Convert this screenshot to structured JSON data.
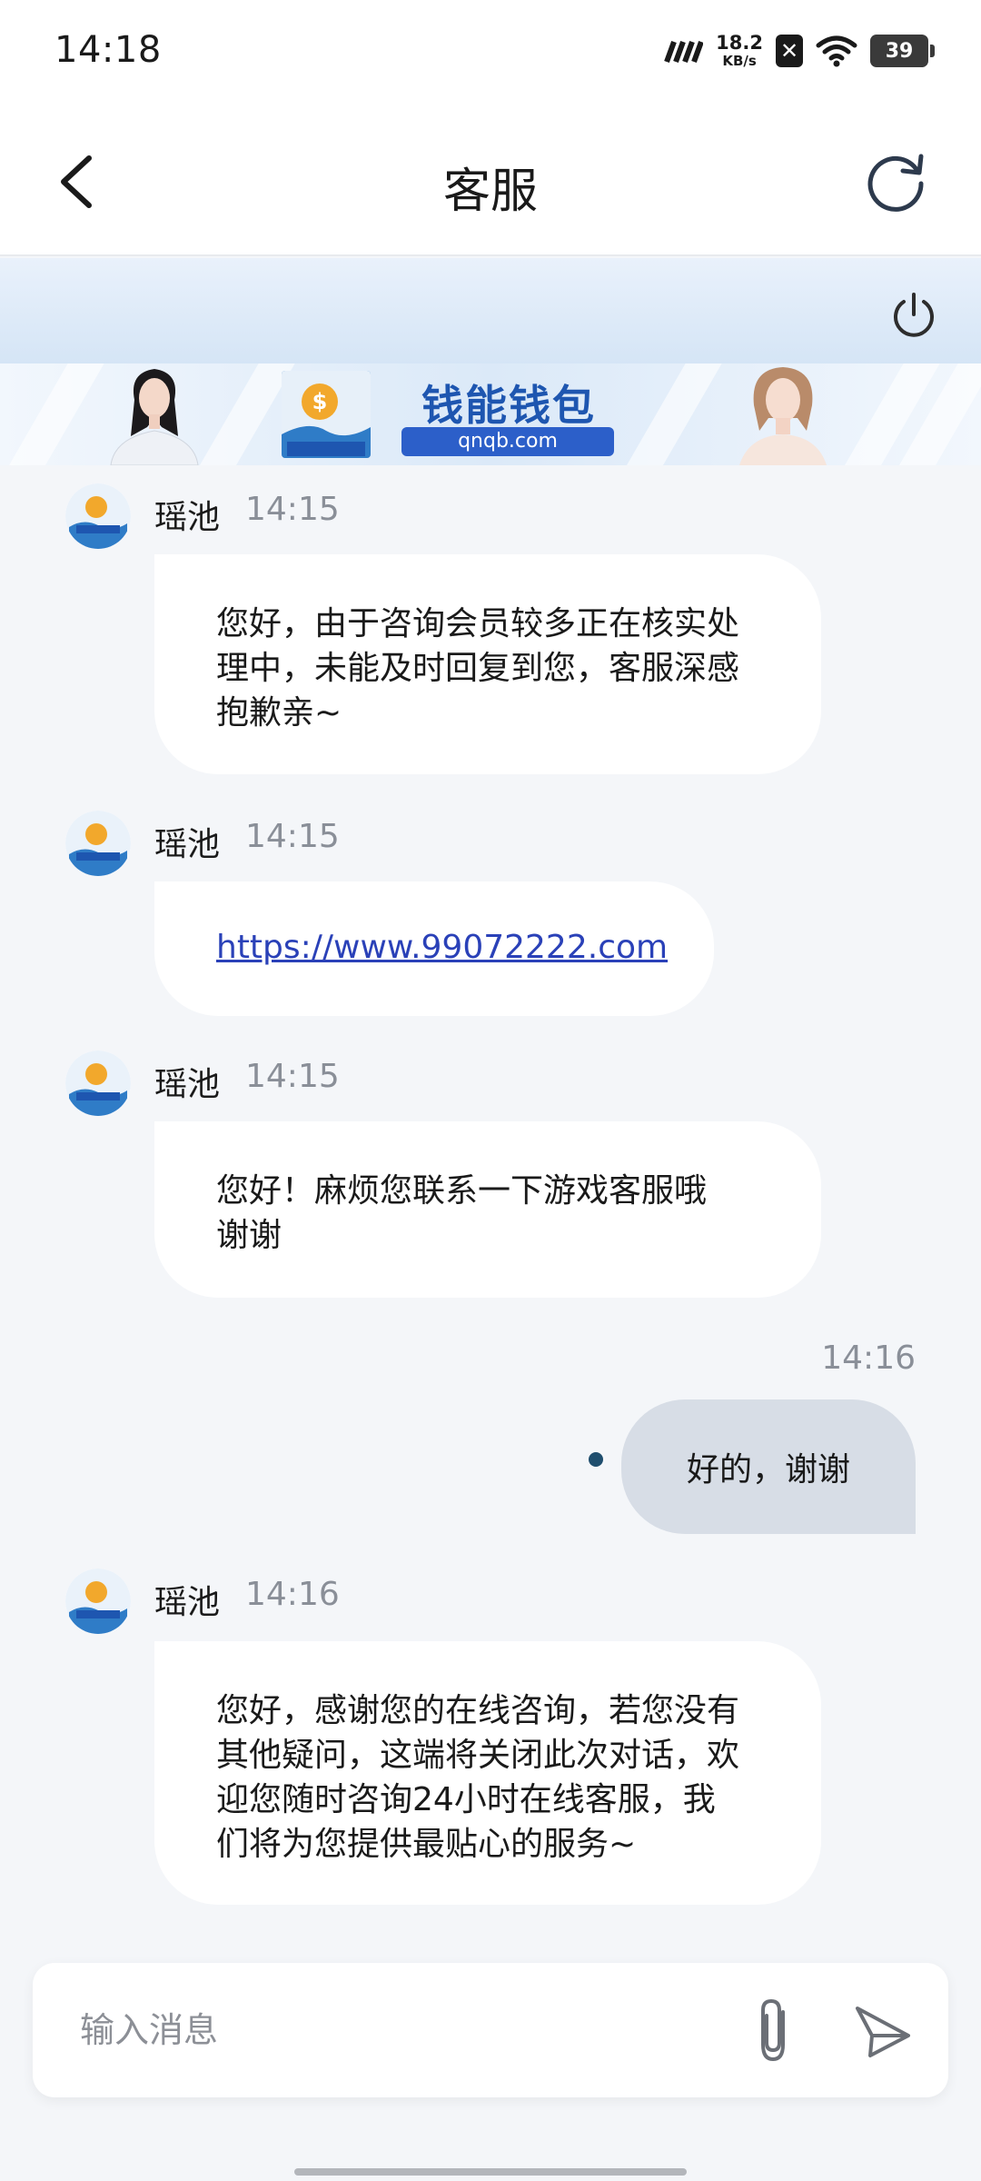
{
  "status_bar": {
    "time": "14:18",
    "net_speed_value": "18.2",
    "net_speed_unit": "KB/s",
    "battery": "39",
    "icons": [
      "signal-icon",
      "blocked-notification-icon",
      "wifi-icon",
      "battery-icon"
    ]
  },
  "header": {
    "title": "客服",
    "back_icon": "chevron-left-icon",
    "refresh_icon": "refresh-icon"
  },
  "top_panel": {
    "power_icon": "power-icon"
  },
  "ad_banner": {
    "brand": "钱能钱包",
    "url": "qnqb.com",
    "logo_text": "钱能钱包"
  },
  "messages": [
    {
      "direction": "in",
      "sender": "瑶池",
      "time": "14:15",
      "lines": [
        "您好，由于咨询会员较多正在核实处",
        "理中，未能及时回复到您，客服深感",
        "抱歉亲~"
      ]
    },
    {
      "direction": "in",
      "sender": "瑶池",
      "time": "14:15",
      "link": "https://www.99072222.com"
    },
    {
      "direction": "in",
      "sender": "瑶池",
      "time": "14:15",
      "lines": [
        "您好！麻烦您联系一下游戏客服哦",
        "谢谢"
      ]
    },
    {
      "direction": "out",
      "time": "14:16",
      "text": "好的，谢谢"
    },
    {
      "direction": "in",
      "sender": "瑶池",
      "time": "14:16",
      "lines": [
        "您好，感谢您的在线咨询，若您没有",
        "其他疑问，这端将关闭此次对话，欢",
        "迎您随时咨询24小时在线客服，我",
        "们将为您提供最贴心的服务~"
      ]
    }
  ],
  "input": {
    "placeholder": "输入消息",
    "value": "",
    "attach_icon": "paperclip-icon",
    "send_icon": "send-icon"
  },
  "colors": {
    "background": "#f4f6f9",
    "incoming_bubble": "#ffffff",
    "outgoing_bubble": "#d7dde6",
    "link": "#2a41b8",
    "banner_blue": "#1e56b0"
  }
}
